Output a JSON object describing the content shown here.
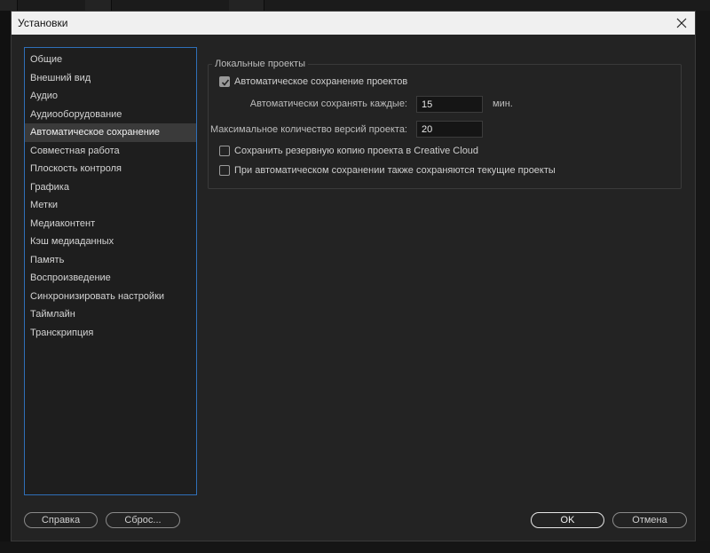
{
  "window": {
    "title": "Установки"
  },
  "sidebar": {
    "items": [
      {
        "label": "Общие"
      },
      {
        "label": "Внешний вид"
      },
      {
        "label": "Аудио"
      },
      {
        "label": "Аудиооборудование"
      },
      {
        "label": "Автоматическое сохранение",
        "active": true
      },
      {
        "label": "Совместная работа"
      },
      {
        "label": "Плоскость контроля"
      },
      {
        "label": "Графика"
      },
      {
        "label": "Метки"
      },
      {
        "label": "Медиаконтент"
      },
      {
        "label": "Кэш медиаданных"
      },
      {
        "label": "Память"
      },
      {
        "label": "Воспроизведение"
      },
      {
        "label": "Синхронизировать настройки"
      },
      {
        "label": "Таймлайн"
      },
      {
        "label": "Транскрипция"
      }
    ]
  },
  "local_projects": {
    "group_label": "Локальные проекты",
    "autosave": {
      "label": "Автоматическое сохранение проектов",
      "checked": true
    },
    "interval": {
      "label": "Автоматически сохранять каждые:",
      "value": "15",
      "unit": "мин."
    },
    "max_versions": {
      "label": "Максимальное количество версий проекта:",
      "value": "20"
    },
    "cloud_backup": {
      "label": "Сохранить резервную копию проекта в Creative Cloud",
      "checked": false
    },
    "save_current": {
      "label": "При автоматическом сохранении также сохраняются текущие проекты",
      "checked": false
    }
  },
  "footer": {
    "help_label": "Справка",
    "reset_label": "Сброс...",
    "ok_label": "OK",
    "cancel_label": "Отмена"
  },
  "colors": {
    "dialog_bg": "#232323",
    "titlebar_bg": "#f0f0f0",
    "sidebar_focus_border": "#2f6fb8",
    "selected_item_bg": "#3a3a3a"
  },
  "icons": {
    "close": "close-icon",
    "check": "checkmark-icon"
  }
}
